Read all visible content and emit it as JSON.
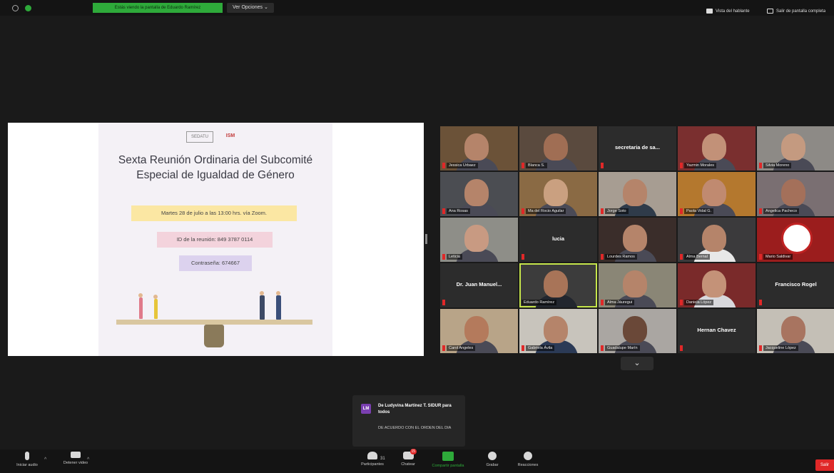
{
  "topbar": {
    "share_banner": "Estás viendo la pantalla de Eduardo Ramírez",
    "view_options": "Ver Opciones ⌄",
    "speaker_view": "Vista del hablante",
    "exit_fullscreen": "Salir de pantalla completa"
  },
  "slide": {
    "logo_left": "SEDATU",
    "logo_right": "ISM",
    "title": "Sexta Reunión Ordinaria del Subcomité Especial de Igualdad de Género",
    "date_line": "Martes 28 de julio a las 13:00 hrs. vía Zoom.",
    "meeting_id": "ID de la reunión: 849 3787 0114",
    "password": "Contraseña: 674667",
    "pill_colors": {
      "date": "#fbe7a3",
      "id": "#f3d3dc",
      "password": "#dcd2ee"
    }
  },
  "participants": [
    {
      "name": "Jessica Urbaez",
      "type": "video",
      "muted": true
    },
    {
      "name": "Blanca S.",
      "type": "video",
      "muted": true
    },
    {
      "name": "secretaria de sa...",
      "type": "text",
      "muted": true
    },
    {
      "name": "Yazmin Morales",
      "type": "video",
      "muted": true
    },
    {
      "name": "Silvia Moreno",
      "type": "video",
      "muted": true
    },
    {
      "name": "Ana Rosas",
      "type": "video",
      "muted": true
    },
    {
      "name": "Ma del Rocio Aguilar",
      "type": "video",
      "muted": true
    },
    {
      "name": "Jorge Soto",
      "type": "video",
      "muted": true
    },
    {
      "name": "Paola Vidal G.",
      "type": "video",
      "muted": true
    },
    {
      "name": "Angelica Pacheco",
      "type": "video",
      "muted": true
    },
    {
      "name": "Leticia",
      "type": "video",
      "muted": true
    },
    {
      "name": "lucia",
      "type": "text",
      "muted": true
    },
    {
      "name": "Lourdes Ramos",
      "type": "video",
      "muted": true
    },
    {
      "name": "Alma Bernal",
      "type": "video",
      "muted": true
    },
    {
      "name": "Mario Saldivar",
      "type": "logo",
      "muted": true
    },
    {
      "name": "Dr. Juan Manuel...",
      "type": "text",
      "muted": true
    },
    {
      "name": "Eduardo Ramírez",
      "type": "video",
      "muted": false,
      "active": true
    },
    {
      "name": "Alma Jáuregui",
      "type": "video",
      "muted": true
    },
    {
      "name": "Daniela López",
      "type": "video",
      "muted": true
    },
    {
      "name": "Francisco Rogel",
      "type": "text",
      "muted": true
    },
    {
      "name": "Carol Angeles",
      "type": "video",
      "muted": true
    },
    {
      "name": "Gabriela Ávila",
      "type": "video",
      "muted": true
    },
    {
      "name": "Guadalupe Marín",
      "type": "video",
      "muted": true
    },
    {
      "name": "Hernan Chavez",
      "type": "text",
      "muted": true
    },
    {
      "name": "Jacqueline López",
      "type": "video",
      "muted": true
    }
  ],
  "chat": {
    "avatar": "LM",
    "from": "De Ludyvina Martínez T. SIDUR para todos",
    "message": "DE ACUERDO CON EL ORDEN DEL DIA"
  },
  "toolbar": {
    "audio": "Iniciar audio",
    "video": "Detener video",
    "participants": "Participantes",
    "participants_count": "31",
    "chat": "Chatear",
    "chat_badge": "15",
    "share": "Compartir pantalla",
    "record": "Grabar",
    "reactions": "Reacciones",
    "end": "Salir"
  },
  "colors": {
    "share_green": "#2eaa3a",
    "active_speaker": "#c6e64b",
    "end_red": "#e02828",
    "muted_red": "#e02828"
  }
}
